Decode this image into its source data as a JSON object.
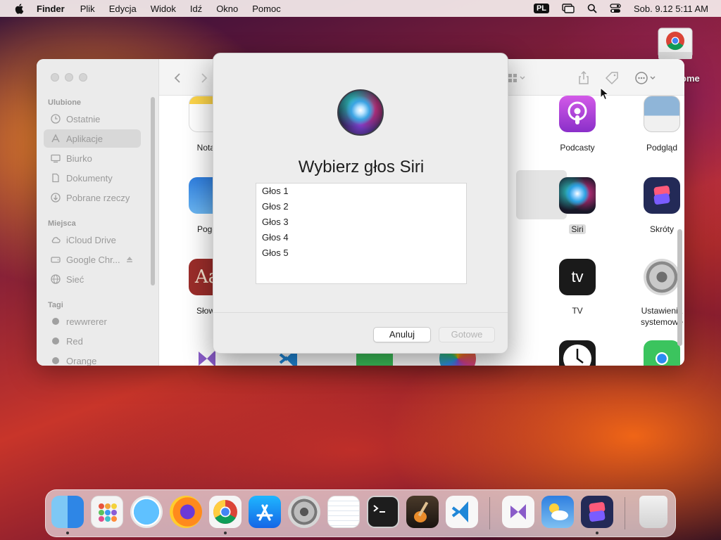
{
  "menubar": {
    "app_name": "Finder",
    "menus": [
      "Plik",
      "Edycja",
      "Widok",
      "Idź",
      "Okno",
      "Pomoc"
    ],
    "input_lang": "PL",
    "clock": "Sob. 9.12  5:11 AM"
  },
  "desktop": {
    "chrome_label": "rome"
  },
  "finder": {
    "sidebar": {
      "favorites_header": "Ulubione",
      "favorites": [
        "Ostatnie",
        "Aplikacje",
        "Biurko",
        "Dokumenty",
        "Pobrane rzeczy"
      ],
      "places_header": "Miejsca",
      "places": [
        "iCloud Drive",
        "Google Chr...",
        "Sieć"
      ],
      "tags_header": "Tagi",
      "tags": [
        "rewwrerer",
        "Red",
        "Orange"
      ]
    },
    "apps": {
      "notes": "Notat",
      "weather": "Pogo",
      "dictionary": "Słowr",
      "podcasts": "Podcasty",
      "preview": "Podgląd",
      "siri": "Siri",
      "shortcuts": "Skróty",
      "tv": "TV",
      "settings_line1": "Ustawienia",
      "settings_line2": "systemowe",
      "dictionary_glyph": "Aa",
      "tv_glyph": "tv"
    }
  },
  "dialog": {
    "title": "Wybierz głos Siri",
    "voices": [
      "Głos 1",
      "Głos 2",
      "Głos 3",
      "Głos 4",
      "Głos 5"
    ],
    "cancel_label": "Anuluj",
    "done_label": "Gotowe"
  },
  "dock": {
    "apps": [
      "Finder",
      "Launchpad",
      "Safari",
      "Firefox",
      "Google Chrome",
      "App Store",
      "Ustawienia systemowe",
      "TextEdit",
      "Terminal",
      "GarageBand",
      "Visual Studio Code",
      "Visual Studio",
      "Pogoda",
      "Skróty",
      "Kosz"
    ]
  }
}
